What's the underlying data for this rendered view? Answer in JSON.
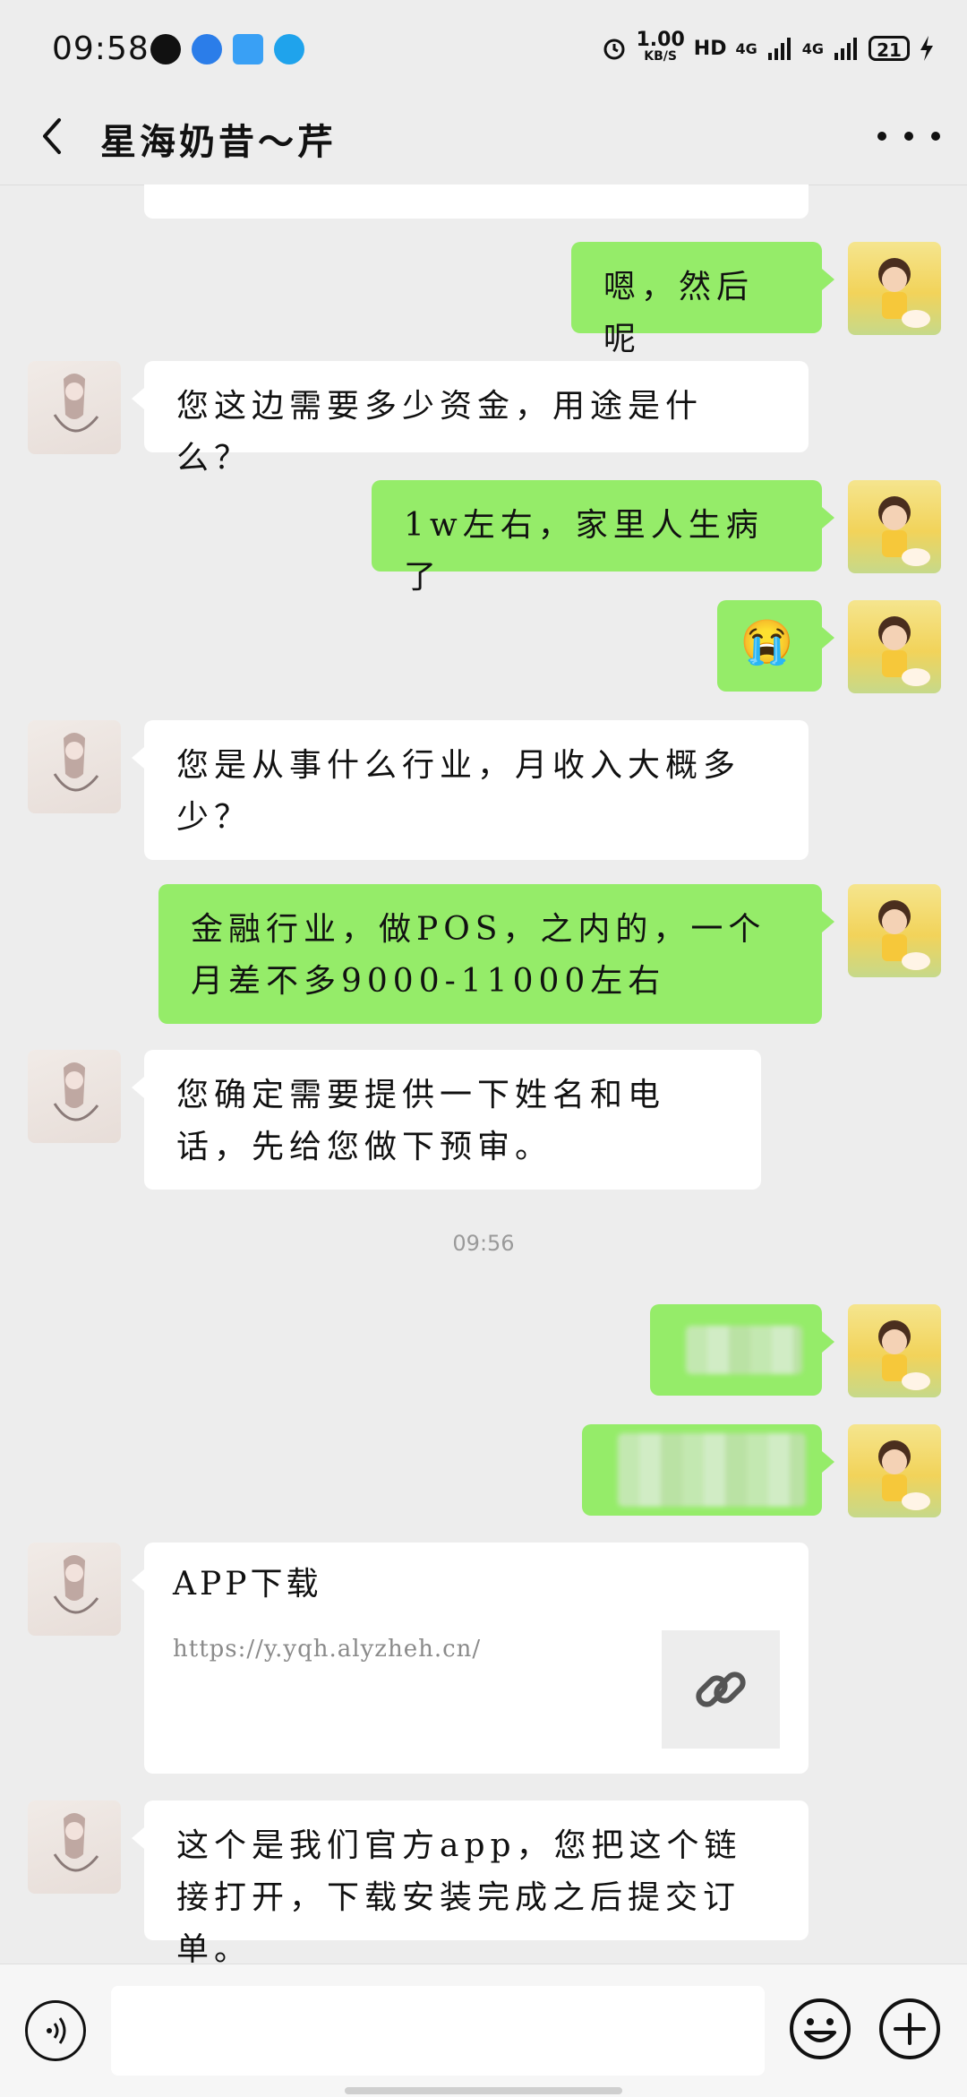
{
  "status_bar": {
    "time": "09:58",
    "net_speed": "1.00",
    "net_unit": "KB/S",
    "hd": "HD",
    "sig1": "4G",
    "sig2": "4G",
    "battery": "21"
  },
  "header": {
    "title": "星海奶昔～芹"
  },
  "messages": [
    {
      "side": "right",
      "text": "嗯，然后呢"
    },
    {
      "side": "left",
      "text": "您这边需要多少资金，用途是什么？"
    },
    {
      "side": "right",
      "text": "1w左右，家里人生病了"
    },
    {
      "side": "right",
      "text": "😭"
    },
    {
      "side": "left",
      "text": "您是从事什么行业，月收入大概多少？"
    },
    {
      "side": "right",
      "text": "金融行业，做POS，之内的，一个月差不多9000-11000左右"
    },
    {
      "side": "left",
      "text": "您确定需要提供一下姓名和电话，先给您做下预审。"
    },
    {
      "side": "left",
      "text": "这个是我们官方app，您把这个链接打开，下载安装完成之后提交订单。"
    }
  ],
  "timestamp": "09:56",
  "link_card": {
    "title": "APP下载",
    "url": "https://y.yqh.alyzheh.cn/",
    "thumb_icon": "link-icon"
  },
  "icons": {
    "back": "chevron-left-icon",
    "more": "more-dots-icon",
    "voice": "voice-icon",
    "emoji": "emoji-icon",
    "plus": "plus-icon"
  },
  "colors": {
    "sent_bubble": "#95ec69",
    "received_bubble": "#ffffff",
    "background": "#ededed"
  }
}
